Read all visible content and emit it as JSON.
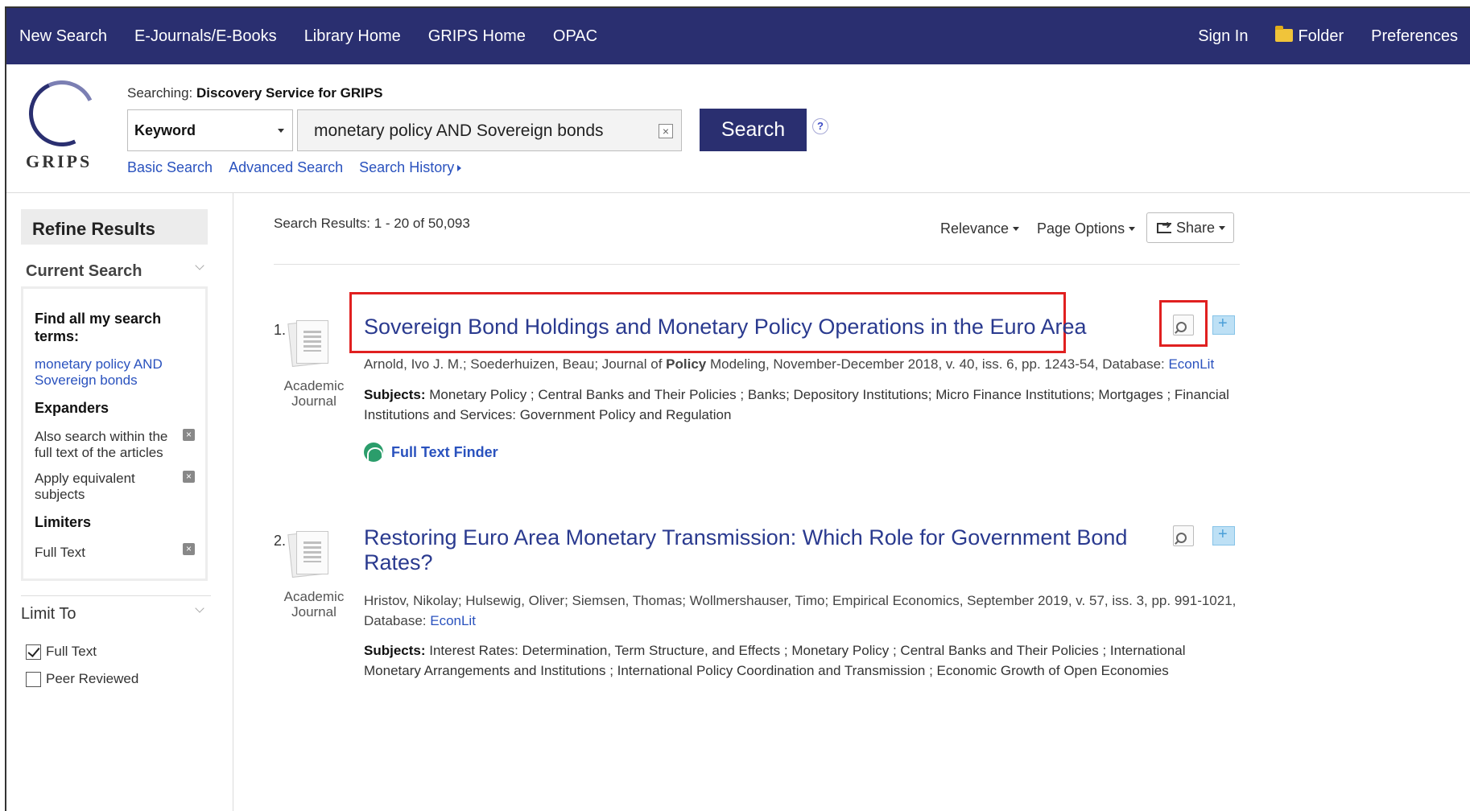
{
  "topnav": {
    "left": [
      "New Search",
      "E-Journals/E-Books",
      "Library Home",
      "GRIPS Home",
      "OPAC"
    ],
    "sign_in": "Sign In",
    "folder": "Folder",
    "preferences": "Preferences"
  },
  "header": {
    "logo_text": "GRIPS",
    "searching_label": "Searching:",
    "searching_target": "Discovery Service for GRIPS",
    "field": "Keyword",
    "query": "monetary policy AND Sovereign bonds",
    "search_button": "Search",
    "help": "?",
    "links": [
      "Basic Search",
      "Advanced Search",
      "Search History"
    ]
  },
  "sidebar": {
    "refine_title": "Refine Results",
    "current_search": "Current Search",
    "find_all": "Find all my search terms:",
    "query_link": "monetary policy AND Sovereign bonds",
    "expanders_title": "Expanders",
    "expanders": [
      "Also search within the full text of the articles",
      "Apply equivalent subjects"
    ],
    "limiters_title": "Limiters",
    "limiters": [
      "Full Text"
    ],
    "limit_to": "Limit To",
    "limit_options": [
      {
        "label": "Full Text",
        "checked": true
      },
      {
        "label": "Peer Reviewed",
        "checked": false
      }
    ]
  },
  "main": {
    "count": "Search Results: 1 - 20 of 50,093",
    "sort": "Relevance",
    "page_options": "Page Options",
    "share": "Share",
    "results": [
      {
        "num": "1.",
        "type_line1": "Academic",
        "type_line2": "Journal",
        "title": "Sovereign Bond Holdings and Monetary Policy Operations in the Euro Area",
        "authors_pre": "Arnold, Ivo J. M.; Soederhuizen, Beau; Journal of ",
        "authors_bold": "Policy",
        "authors_post": " Modeling, November-December 2018, v. 40, iss. 6, pp. 1243-54, Database: ",
        "database": "EconLit",
        "subjects_label": "Subjects:",
        "subjects": " Monetary Policy ; Central Banks and Their Policies ; Banks; Depository Institutions; Micro Finance Institutions; Mortgages ; Financial Institutions and Services: Government Policy and Regulation",
        "fulltext": "Full Text Finder"
      },
      {
        "num": "2.",
        "type_line1": "Academic",
        "type_line2": "Journal",
        "title": "Restoring Euro Area Monetary Transmission: Which Role for Government Bond Rates?",
        "authors_pre": "Hristov, Nikolay; Hulsewig, Oliver; Siemsen, Thomas; Wollmershauser, Timo; Empirical Economics, September 2019, v. 57, iss. 3, pp. 991-1021, Database: ",
        "database": "EconLit",
        "subjects_label": "Subjects:",
        "subjects": " Interest Rates: Determination, Term Structure, and Effects ; Monetary Policy ; Central Banks and Their Policies ; International Monetary Arrangements and Institutions ; International Policy Coordination and Transmission ; Economic Growth of Open Economies"
      }
    ]
  },
  "colors": {
    "nav_bg": "#2a2f70",
    "link": "#2a52be",
    "title": "#2a3a8f",
    "highlight": "#e02020"
  }
}
